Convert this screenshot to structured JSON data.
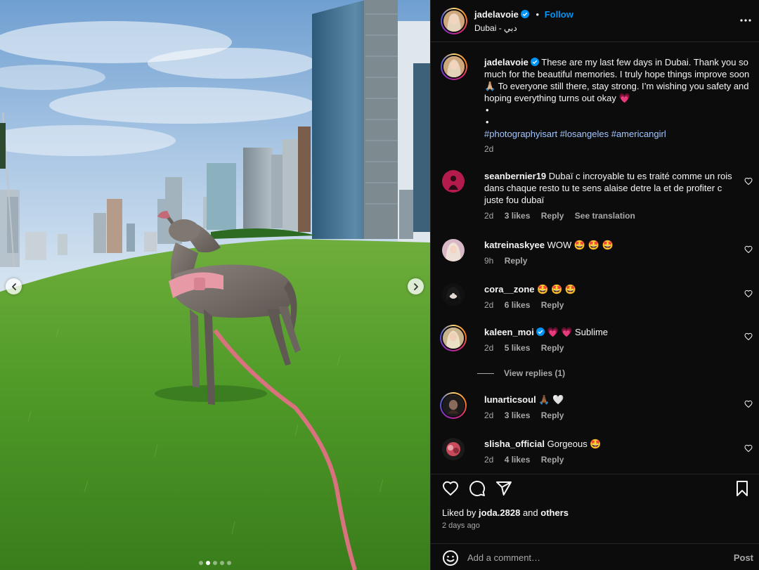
{
  "colors": {
    "accent": "#0095f6",
    "heart": "#ff3040",
    "panel": "#0c0c0c",
    "muted": "#a8a8a8"
  },
  "media": {
    "prev_icon": "chevron-left-icon",
    "next_icon": "chevron-right-icon",
    "carousel": {
      "count": 5,
      "active_index": 1
    }
  },
  "header": {
    "username": "jadelavoie",
    "separator": "•",
    "follow_label": "Follow",
    "location": "Dubai - دبي"
  },
  "caption": {
    "username": "jadelavoie",
    "text": "These are my last few days in Dubai. Thank you so much for the beautiful memories. I truly hope things improve soon 🙏🏼 To everyone still there, stay strong. I’m wishing you safety and hoping everything turns out okay 💗",
    "bullet1": "•",
    "bullet2": "•",
    "hashtags": [
      "#photographyisart",
      "#losangeles",
      "#americangirl"
    ],
    "time": "2d"
  },
  "comments": [
    {
      "username": "seanbernier19",
      "text": "Dubaï c incroyable tu es traité comme un rois dans chaque resto tu te sens alaise detre la et de profiter c juste fou dubaï",
      "time": "2d",
      "likes": "3 likes",
      "reply": "Reply",
      "translation": "See translation"
    },
    {
      "username": "katreinaskyee",
      "text": "WOW 🤩 🤩 🤩",
      "time": "9h",
      "reply": "Reply"
    },
    {
      "username": "cora__zone",
      "text": "🤩 🤩 🤩",
      "time": "2d",
      "likes": "6 likes",
      "reply": "Reply"
    },
    {
      "username": "kaleen_moi",
      "text": "💗 💗 Sublime",
      "time": "2d",
      "likes": "5 likes",
      "reply": "Reply"
    },
    {
      "username": "lunarticsoul",
      "text": "🙏🏾 🤍",
      "time": "2d",
      "likes": "3 likes",
      "reply": "Reply"
    },
    {
      "username": "slisha_official",
      "text": "Gorgeous 🤩",
      "time": "2d",
      "likes": "4 likes",
      "reply": "Reply"
    }
  ],
  "view_replies": "View replies (1)",
  "footer": {
    "liked_prefix": "Liked by",
    "liked_user": "joda.2828",
    "liked_and": "and",
    "liked_others": "others",
    "time_ago": "2 days ago",
    "comment_placeholder": "Add a comment…",
    "post_label": "Post"
  }
}
